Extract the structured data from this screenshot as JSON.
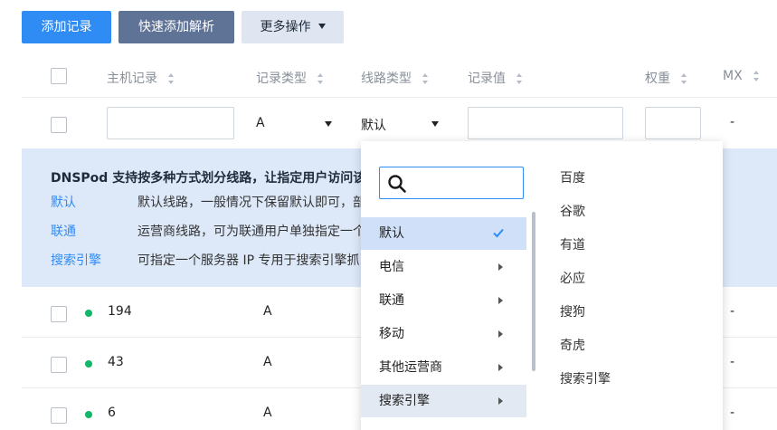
{
  "toolbar": {
    "add_record": "添加记录",
    "quick_add": "快速添加解析",
    "more_actions": "更多操作"
  },
  "table": {
    "headers": {
      "host": "主机记录",
      "type": "记录类型",
      "line": "线路类型",
      "value": "记录值",
      "weight": "权重",
      "mx": "MX"
    },
    "new_row": {
      "type_value": "A",
      "line_value": "默认",
      "mx_value": "-"
    },
    "rows": [
      {
        "host": "194",
        "type": "A",
        "mx": "-"
      },
      {
        "host": "43",
        "type": "A",
        "mx": "-"
      },
      {
        "host": "6",
        "type": "A",
        "mx": "-"
      }
    ]
  },
  "info": {
    "title": "DNSPod 支持按多种方式划分线路，让指定用户访问该",
    "items": [
      {
        "link": "默认",
        "desc": "默认线路，一般情况下保留默认即可，部"
      },
      {
        "link": "联通",
        "desc": "运营商线路，可为联通用户单独指定一个"
      },
      {
        "link": "搜索引擎",
        "desc": "可指定一个服务器 IP 专用于搜索引擎抓"
      }
    ]
  },
  "dropdown": {
    "search_placeholder": "",
    "menu": [
      {
        "label": "默认",
        "selected": true
      },
      {
        "label": "电信"
      },
      {
        "label": "联通"
      },
      {
        "label": "移动"
      },
      {
        "label": "其他运营商"
      },
      {
        "label": "搜索引擎",
        "active": true
      }
    ],
    "submenu": [
      "百度",
      "谷歌",
      "有道",
      "必应",
      "搜狗",
      "奇虎",
      "搜索引擎"
    ]
  },
  "colors": {
    "primary": "#2f8cf5",
    "secondary": "#5f7396",
    "status_ok": "#12b66a",
    "info_bg": "#dde8f8"
  }
}
